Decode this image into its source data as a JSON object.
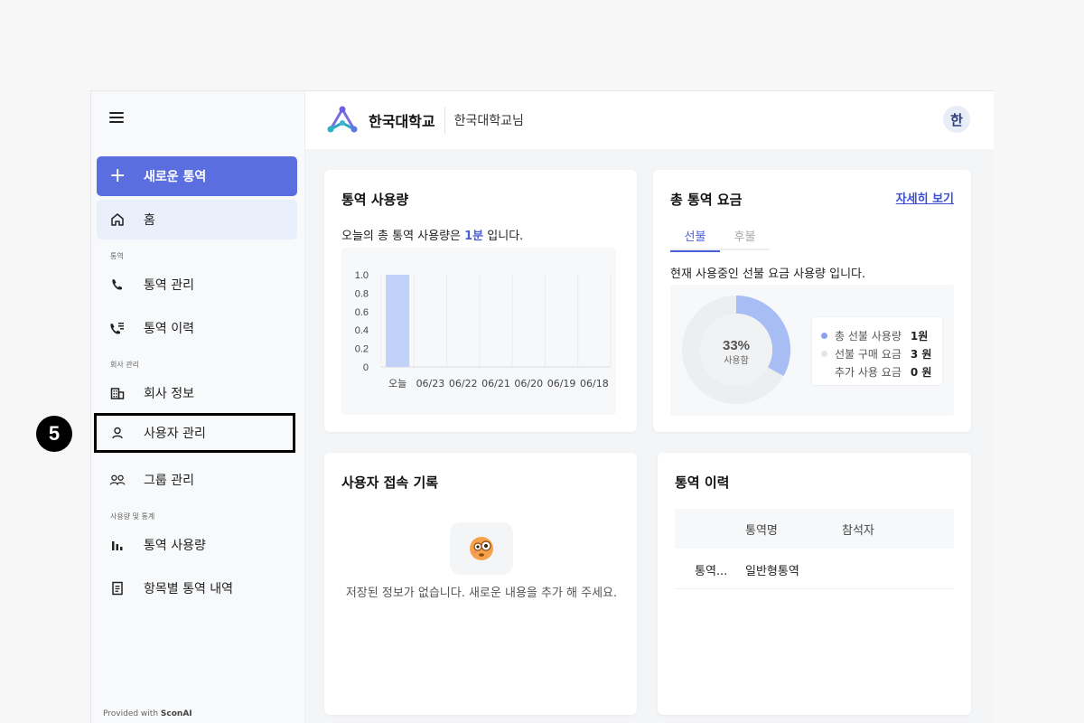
{
  "step": {
    "number": "5"
  },
  "sidebar": {
    "new_button": "새로운 통역",
    "home": "홈",
    "section_interp": "통역",
    "interp_manage": "통역 관리",
    "interp_history": "통역 이력",
    "section_company": "회사 관리",
    "company_info": "회사 정보",
    "user_manage": "사용자 관리",
    "group_manage": "그룹 관리",
    "section_usage": "사용량 및 통계",
    "usage": "통역 사용량",
    "itemized": "항목별 통역 내역",
    "provided_prefix": "Provided with",
    "provided_brand": "SconAI"
  },
  "header": {
    "org_name": "한국대학교",
    "user_name": "한국대학교님",
    "avatar": "한"
  },
  "usage_card": {
    "title": "통역 사용량",
    "text_prefix": "오늘의 총 통역 사용량은",
    "text_value": "1분",
    "text_suffix": "입니다."
  },
  "fee_card": {
    "title": "총 통역 요금",
    "detail_link": "자세히 보기",
    "tab_prepaid": "선불",
    "tab_postpaid": "후불",
    "desc": "현재 사용중인 선불 요금 사용량 입니다.",
    "donut_percent": "33%",
    "donut_label": "사용함",
    "usage_fraction": 0.33,
    "legend": [
      {
        "label": "총 선불 사용량",
        "value": "1원",
        "color": "#8aa2ef"
      },
      {
        "label": "선불 구매 요금",
        "value": "3 원",
        "color": "#e3e5e8"
      },
      {
        "label": "추가 사용 요금",
        "value": "0 원",
        "color": ""
      }
    ],
    "colors": {
      "used": "#a9bdf5",
      "remaining": "#eceef0"
    }
  },
  "access_card": {
    "title": "사용자 접속 기록",
    "empty_text": "저장된 정보가 없습니다. 새로운 내용을 추가 해 주세요."
  },
  "history_card": {
    "title": "통역 이력",
    "col_name": "통역명",
    "col_participants": "참석자",
    "rows": [
      {
        "first": "통역...",
        "name": "일반형통역",
        "participants": ""
      }
    ]
  },
  "chart_data": {
    "type": "bar",
    "categories": [
      "오늘",
      "06/23",
      "06/22",
      "06/21",
      "06/20",
      "06/19",
      "06/18"
    ],
    "values": [
      1,
      0,
      0,
      0,
      0,
      0,
      0
    ],
    "ylim": [
      0,
      1
    ],
    "yticks": [
      "1.0",
      "0.8",
      "0.6",
      "0.4",
      "0.2",
      "0"
    ],
    "bar_color": "#c2d1f7",
    "grid": true
  }
}
